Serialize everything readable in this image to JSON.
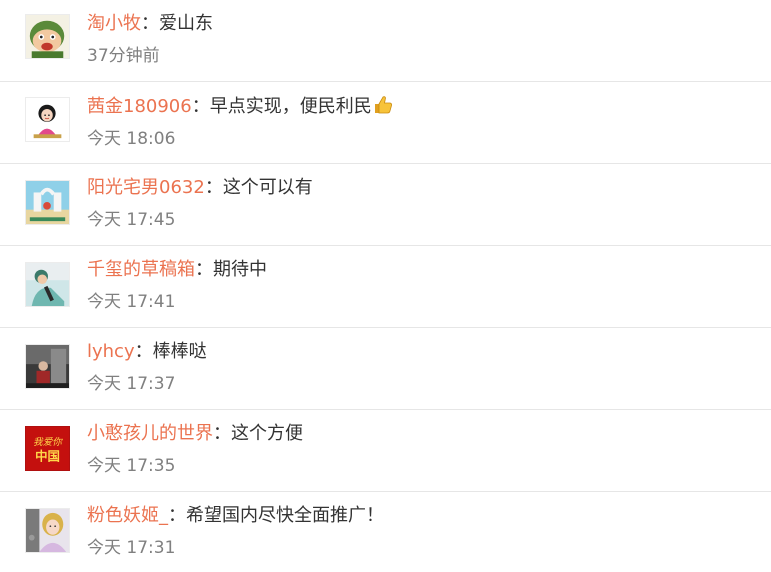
{
  "comments": [
    {
      "user": "淘小牧",
      "sep": "：",
      "text": "爱山东",
      "time": "37分钟前"
    },
    {
      "user": "茜金180906",
      "sep": "：",
      "text": "早点实现，便民利民",
      "time": "今天 18:06",
      "emoji": "thumbs-up"
    },
    {
      "user": "阳光宅男0632",
      "sep": "：",
      "text": "这个可以有",
      "time": "今天 17:45"
    },
    {
      "user": "千玺的草稿箱",
      "sep": "：",
      "text": "期待中",
      "time": "今天 17:41"
    },
    {
      "user": "lyhcy",
      "sep": "：",
      "text": "棒棒哒",
      "time": "今天 17:37"
    },
    {
      "user": "小憨孩儿的世界",
      "sep": "：",
      "text": "这个方便",
      "time": "今天 17:35",
      "avatar_text": "我爱你中国"
    },
    {
      "user": "粉色妖姬_",
      "sep": "：",
      "text": "希望国内尽快全面推广！",
      "time": "今天 17:31"
    }
  ],
  "colors": {
    "username": "#eb7350",
    "text": "#333333",
    "time": "#808080",
    "divider": "#e6e6e6"
  }
}
